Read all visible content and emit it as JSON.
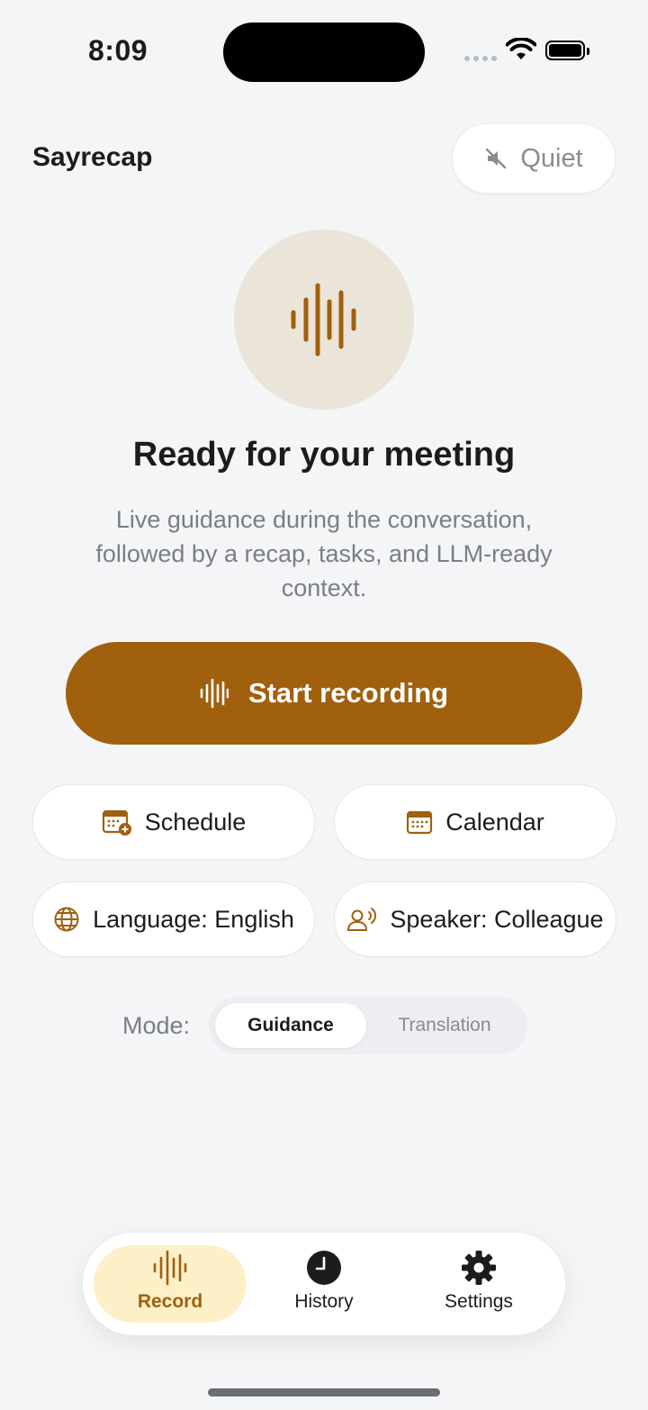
{
  "status_bar": {
    "time": "8:09"
  },
  "header": {
    "app_title": "Sayrecap",
    "quiet_label": "Quiet"
  },
  "hero": {
    "headline": "Ready for your meeting",
    "subtitle": "Live guidance during the conversation, followed by a recap, tasks, and LLM-ready context."
  },
  "primary_action": {
    "label": "Start recording"
  },
  "options": {
    "schedule": "Schedule",
    "calendar": "Calendar",
    "language": "Language: English",
    "speaker": "Speaker: Colleague"
  },
  "mode": {
    "label": "Mode:",
    "options": [
      "Guidance",
      "Translation"
    ],
    "selected": "Guidance"
  },
  "tabs": [
    {
      "label": "Record",
      "icon": "waveform-icon",
      "active": true
    },
    {
      "label": "History",
      "icon": "clock-icon",
      "active": false
    },
    {
      "label": "Settings",
      "icon": "gear-icon",
      "active": false
    }
  ],
  "colors": {
    "accent": "#a0600e",
    "active_tab_bg": "#fdf0c9",
    "background": "#f3f5f7"
  }
}
